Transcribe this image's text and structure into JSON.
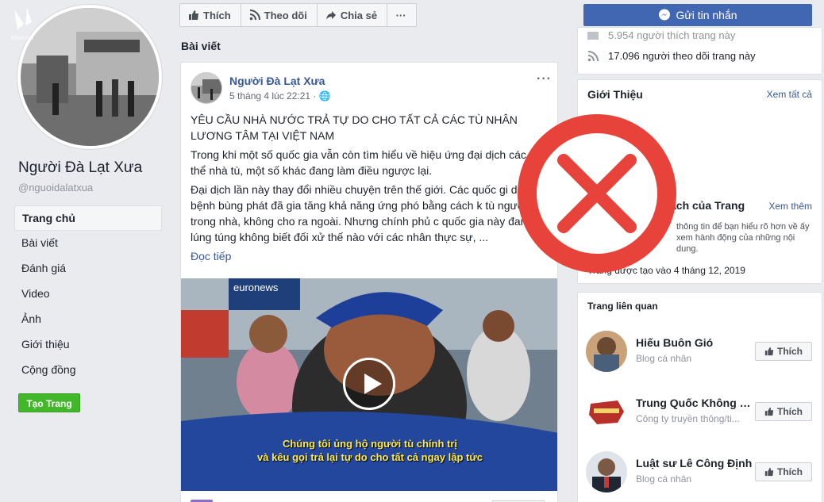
{
  "page": {
    "name": "Người Đà Lạt Xưa",
    "handle": "@nguoidalatxua",
    "logo_text": "ĐÀNH GỒ"
  },
  "nav": [
    "Trang chủ",
    "Bài viết",
    "Đánh giá",
    "Video",
    "Ảnh",
    "Giới thiệu",
    "Cộng đồng"
  ],
  "create_page": "Tạo Trang",
  "actions": {
    "like": "Thích",
    "follow": "Theo dõi",
    "share": "Chia sẻ",
    "more": "···"
  },
  "message_button": "Gửi tin nhắn",
  "posts_section_title": "Bài viết",
  "post": {
    "author": "Người Đà Lạt Xưa",
    "time": "5 tháng 4 lúc 22:21 · ",
    "headline": "YÊU CẦU NHÀ NƯỚC TRẢ TỰ DO CHO TẤT CẢ CÁC TÙ NHÂN LƯƠNG TÂM TẠI VIỆT NAM",
    "para1": "Trong khi một số quốc gia vẫn còn tìm hiểu về hiệu ứng đại dịch các quần thể nhà tù, một số khác đang làm điều ngược lại.",
    "para2": "Đại dịch lần này thay đổi nhiều chuyện trên thế giới. Các quốc gi dịch bệnh bùng phát đã gia tăng khả năng ứng phó bằng cách k tù người dân trong nhà, không cho ra ngoài. Nhưng chính phủ c quốc gia này đang bị lúng túng không biết đối xử thế nào với các nhân thực sự, ...",
    "read_more": "Đọc tiếp",
    "video_watermark": "euronews",
    "video_subtitle_1": "Chúng tôi ủng hộ người tù chính trị",
    "video_subtitle_2": "và kêu gọi trả lại tự do cho tất cả ngay lập tức"
  },
  "right": {
    "stats_partial": "5.954 người thích trang này",
    "followers": "17.096 người theo dõi trang này",
    "about_title": "Giới Thiệu",
    "see_all": "Xem tất cả",
    "transparency_title": "ạch của Trang",
    "see_more": "Xem thêm",
    "transparency_text": "thông tin để bạn hiểu rõ hơn về ấy xem hành động của những nội dung.",
    "created": "Trang được tạo vào 4 tháng 12, 2019",
    "related_title": "Trang liên quan",
    "related": [
      {
        "name": "Hiếu Buôn Gió",
        "category": "Blog cá nhân",
        "button": "Thích"
      },
      {
        "name": "Trung Quốc Không Ki...",
        "category": "Công ty truyền thông/ti...",
        "button": "Thích"
      },
      {
        "name": "Luật sư Lê Công Định",
        "category": "Blog cá nhân",
        "button": "Thích"
      }
    ]
  },
  "colors": {
    "accent": "#4267b2",
    "link": "#385898",
    "green": "#42b72a",
    "red_x": "#e8433a"
  }
}
